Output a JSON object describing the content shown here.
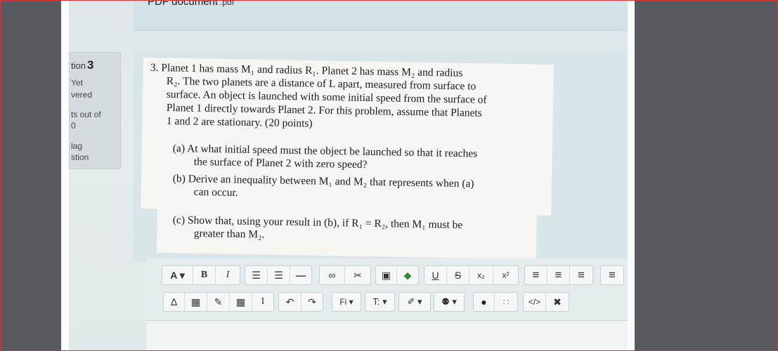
{
  "attachment": {
    "name": "PDF document",
    "ext": ".pdf"
  },
  "sidebar": {
    "question_label": "tion",
    "question_number": "3",
    "status_line1": "Yet",
    "status_line2": "vered",
    "marks_line1": "ts out of",
    "marks_line2": "0",
    "flag_line1": "lag",
    "flag_line2": "stion"
  },
  "question": {
    "lines": [
      "3.  Planet 1 has mass M₁ and radius R₁.  Planet 2 has mass M₂ and radius",
      "R₂.  The two planets are a distance of L apart, measured from surface to",
      "surface.  An object is launched with some initial speed from the surface of",
      "Planet 1 directly towards Planet 2.  For this problem, assume that Planets",
      "1 and 2 are stationary.  (20 points)"
    ],
    "part_a": [
      "(a)  At what initial speed must the object be launched so that it reaches",
      "the surface of Planet 2 with zero speed?"
    ],
    "part_b": [
      "(b)  Derive an inequality between M₁ and M₂ that represents when (a)",
      "can occur."
    ],
    "part_c": [
      "(c)  Show that, using your result in (b), if R₁ = R₂, then M₁ must be",
      "greater than M₂."
    ]
  },
  "toolbar": {
    "row1": {
      "font_color": "A ▾",
      "bold": "B",
      "italic": "I",
      "bullet_list": "☰",
      "numbered_list": "☰",
      "horizontal_line": "—",
      "link": "∞",
      "unlink": "✂",
      "image": "▣",
      "media": "◆",
      "underline": "U",
      "strikethrough": "S",
      "subscript": "x₂",
      "superscript": "x²",
      "align_left": "≡",
      "align_center": "≡",
      "align_right": "≡",
      "indent": "≡"
    },
    "row2": {
      "equation": "∆",
      "calculator": "▦",
      "edit": "✎",
      "table": "▦",
      "cursor": "I",
      "undo": "↶",
      "redo": "↷",
      "font_family": "Fi ▾",
      "font_size": "T: ▾",
      "brush": "✐ ▾",
      "hint": "⚉ ▾",
      "accessibility": "●",
      "special_chars": "∷",
      "html": "</>",
      "fullscreen": "✖"
    }
  }
}
